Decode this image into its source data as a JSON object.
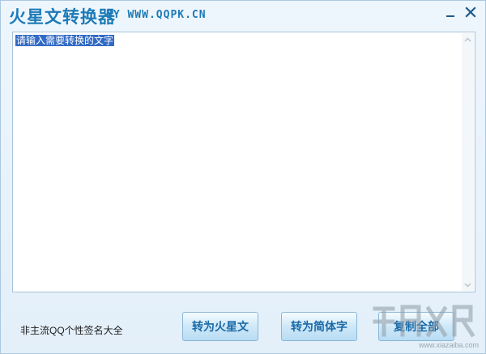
{
  "window": {
    "title": "火星文转换器",
    "subtitle": "BY WWW.QQPK.CN"
  },
  "editor": {
    "selected_text": "请输入需要转换的文字"
  },
  "footer": {
    "link_text": "非主流QQ个性签名大全"
  },
  "buttons": {
    "to_mars": "转为火星文",
    "to_simplified": "转为简体字",
    "copy_all": "复制全部"
  },
  "watermark": {
    "site": "www.xiazaiba.com"
  },
  "icons": {
    "minimize": "minimize-icon",
    "close": "close-icon",
    "scroll_up": "arrow-up-icon",
    "scroll_down": "arrow-down-icon"
  },
  "colors": {
    "title": "#1d7ab8",
    "button_text": "#1a6aa8",
    "selection": "#316ac5"
  }
}
